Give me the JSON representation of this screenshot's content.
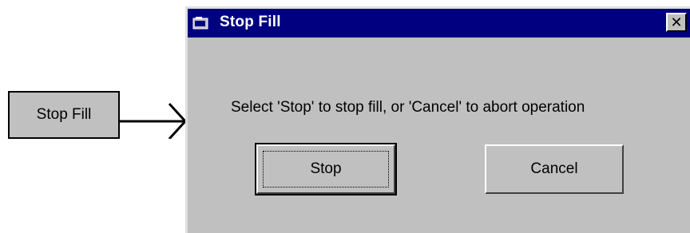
{
  "callout": {
    "label": "Stop Fill"
  },
  "dialog": {
    "title": "Stop Fill",
    "close_symbol": "✕",
    "message": "Select 'Stop' to stop fill, or 'Cancel' to abort operation",
    "buttons": {
      "stop": "Stop",
      "cancel": "Cancel"
    }
  },
  "colors": {
    "titlebar": "#000080",
    "dialog_background": "#c0c0c0",
    "title_text": "#ffffff"
  },
  "icons": [
    "window-app-icon",
    "close-icon",
    "arrow-right-icon"
  ]
}
